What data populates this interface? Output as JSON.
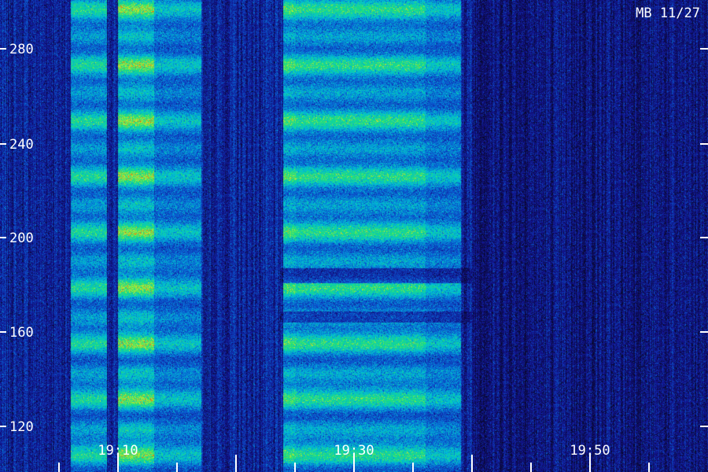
{
  "chart_data": {
    "type": "heatmap",
    "title": "MB 11/27",
    "y_ticks": [
      120,
      160,
      200,
      240,
      280
    ],
    "x_labels": [
      "19:10",
      "19:30",
      "19:50"
    ],
    "x_range_time": [
      "19:05",
      "19:55"
    ],
    "y_range": [
      110,
      290
    ],
    "intensity_scale": "blue-cyan-green-yellow-red",
    "features": [
      {
        "name": "column-a",
        "t_start": "19:06",
        "t_end": "19:09",
        "level": 0.7
      },
      {
        "name": "column-b",
        "t_start": "19:10",
        "t_end": "19:13",
        "level": 0.95
      },
      {
        "name": "column-c",
        "t_start": "19:13",
        "t_end": "19:17",
        "level": 0.55
      },
      {
        "name": "column-d",
        "t_start": "19:24",
        "t_end": "19:25",
        "level": 0.85
      },
      {
        "name": "column-e",
        "t_start": "19:25",
        "t_end": "19:36",
        "level": 0.75
      },
      {
        "name": "column-f",
        "t_start": "19:36",
        "t_end": "19:39",
        "level": 0.55
      }
    ],
    "colors": {
      "background": "#0a0a3a",
      "low": "#1414a0",
      "mid": "#00bcd4",
      "high": "#22e07a",
      "peak": "#ff2a00"
    }
  }
}
